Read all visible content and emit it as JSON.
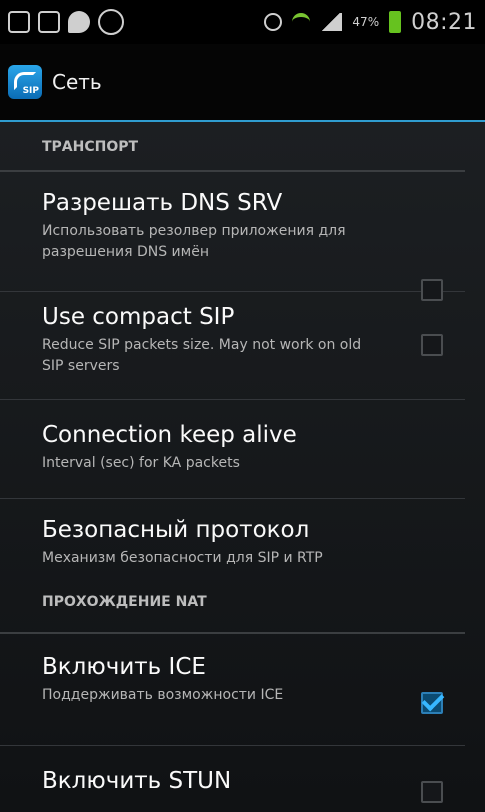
{
  "status_bar": {
    "battery_percent": "47%",
    "time": "08:21"
  },
  "action_bar": {
    "title": "Сеть",
    "app_icon_text": "SIP"
  },
  "sections": [
    {
      "header": "ТРАНСПОРТ",
      "prefs": [
        {
          "title": "Разрешать DNS SRV",
          "summary": "Использовать резолвер приложения для разрешения DNS имён",
          "checkbox": true,
          "checked": false
        },
        {
          "title": "Use compact SIP",
          "summary": "Reduce SIP packets size. May not work on old SIP servers",
          "checkbox": true,
          "checked": false
        },
        {
          "title": "Connection keep alive",
          "summary": "Interval (sec) for KA packets",
          "checkbox": false
        },
        {
          "title": "Безопасный протокол",
          "summary": "Механизм безопасности для SIP и RTP",
          "checkbox": false
        }
      ]
    },
    {
      "header": "ПРОХОЖДЕНИЕ NAT",
      "prefs": [
        {
          "title": "Включить ICE",
          "summary": "Поддерживать возможности ICE",
          "checkbox": true,
          "checked": true
        },
        {
          "title": "Включить STUN",
          "summary": "",
          "checkbox": true,
          "checked": false
        }
      ]
    }
  ],
  "colors": {
    "accent": "#2f9ccf",
    "check": "#37b7ff",
    "battery": "#66c21f"
  }
}
